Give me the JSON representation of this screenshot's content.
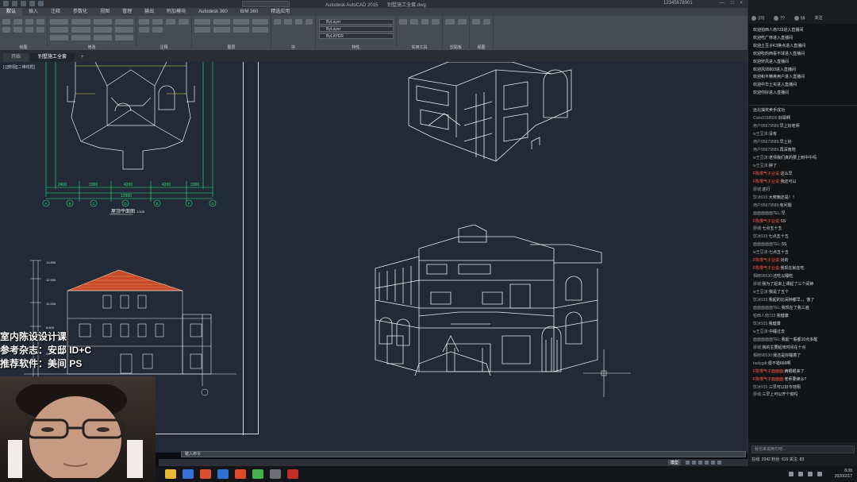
{
  "window": {
    "title": "Autodesk AutoCAD 2015",
    "filename": "别墅施工全套.dwg",
    "user_label": "12345678901",
    "controls": [
      "—",
      "□",
      "×"
    ]
  },
  "menu_tabs": [
    "默认",
    "插入",
    "注释",
    "参数化",
    "视图",
    "管理",
    "输出",
    "附加模块",
    "Autodesk 360",
    "BIM 360",
    "精选应用"
  ],
  "ribbon": {
    "panels": [
      "绘图",
      "修改",
      "注释",
      "图层",
      "块",
      "特性",
      "实用工具",
      "剪贴板",
      "视图"
    ],
    "layer_combo": "ByLayer",
    "linetype_combo": "ByLayer",
    "lineweight_combo": "ByLAYER"
  },
  "doc_tabs": [
    "开始",
    "别墅施工全套"
  ],
  "view_label": "[-][俯视][二维线框]",
  "drawing": {
    "plan_title": "屋顶平面图",
    "plan_scale": "1:100",
    "plan_dims": [
      "2400",
      "3300",
      "4200",
      "4200",
      "3300",
      "12900"
    ],
    "axis_bubbles": [
      "A",
      "B",
      "C",
      "D",
      "E",
      "F",
      "G"
    ],
    "elev_levels": [
      "13.800",
      "12.900",
      "10.200",
      "6.600",
      "3.300"
    ]
  },
  "command_placeholder": "键入命令",
  "status": {
    "model": "模型"
  },
  "overlay_text": [
    "室内陈设设计课",
    "参考杂志：安邸 ID+C",
    "推荐软件：美间 PS"
  ],
  "chat": {
    "header_tabs": [
      "370",
      "??",
      "59",
      "关注"
    ],
    "system_messages": [
      "欢迎拍西人南733进入直播间",
      "欢迎吃广林进入直播间",
      "欢迎土豆子K3换点进入直播间",
      "欢迎吹的西看不球进入直播间",
      "欢迎轩风进入直播间",
      "欢迎风95803进入直播间",
      "欢迎和平精英用户进入直播间",
      "欢迎中华土实进入直播间",
      "欢迎你好进入直播间"
    ],
    "messages": [
      {
        "name": "",
        "text": "远北抽奖卖手成功"
      },
      {
        "name": "Cicle9158505:",
        "text": "好耶啊"
      },
      {
        "name": "用户95679589:",
        "text": "早上好老师"
      },
      {
        "name": "w王豆沫:",
        "text": "没有"
      },
      {
        "name": "用户95679589:",
        "text": "早上好"
      },
      {
        "name": "用户95679589:",
        "text": "再深南地"
      },
      {
        "name": "w王豆沫:",
        "text": "老师我们真的要上到中午吗"
      },
      {
        "name": "w王豆沫:",
        "text": "肿了"
      },
      {
        "name": "F陈慢气子业说:",
        "text": "这么早",
        "red": true
      },
      {
        "name": "F陈慢气子业说:",
        "text": "我还可以",
        "red": true
      },
      {
        "name": "廖城:",
        "text": "还行"
      },
      {
        "name": "饮冰915:",
        "text": "大佬晚还是！！"
      },
      {
        "name": "用户95679589:",
        "text": "有问题"
      },
      {
        "name": "面面面面面TEL:",
        "text": "早"
      },
      {
        "name": "F陈慢气子业说:",
        "text": "SS",
        "red": true
      },
      {
        "name": "廖城:",
        "text": "七点五十五"
      },
      {
        "name": "饮冰915:",
        "text": "七点五十五"
      },
      {
        "name": "面面面面面TEL:",
        "text": "SS"
      },
      {
        "name": "w王豆沫:",
        "text": "七点五十五"
      },
      {
        "name": "F陈慢气子业说:",
        "text": "对的",
        "red": true
      },
      {
        "name": "F陈慢气子业说:",
        "text": "我现在就在吃",
        "red": true
      },
      {
        "name": "相郎95530:",
        "text": "还吃以睡吃"
      },
      {
        "name": "廖城:",
        "text": "我为了起来上课起了三个闹钟"
      },
      {
        "name": "w王豆沫:",
        "text": "我是了五个"
      },
      {
        "name": "饮冰915:",
        "text": "我起的比闹钟都早，，饿了"
      },
      {
        "name": "面面面面面TEL:",
        "text": "我现在了我三遍"
      },
      {
        "name": "柏西人南733:",
        "text": "我健康"
      },
      {
        "name": "饮冰915:",
        "text": "我健康"
      },
      {
        "name": "w王豆沫:",
        "text": "中睡过去"
      },
      {
        "name": "面面面面面TEL:",
        "text": "我起一般都10点多醒"
      },
      {
        "name": "廖城:",
        "text": "我的主要起床时间在十点"
      },
      {
        "name": "相郎95530:",
        "text": "我还是好睡着了"
      },
      {
        "name": "hsdygdt:",
        "text": "很不错666啊"
      },
      {
        "name": "F陈慢气子面面面:",
        "text": "两眼眼来了",
        "red": true
      },
      {
        "name": "F陈慢气子面面面:",
        "text": "老师要蜂么?",
        "red": true
      },
      {
        "name": "饮冰915:",
        "text": "三早可以好今地阳"
      },
      {
        "name": "廖城:",
        "text": "三早上可以开个窗吗"
      }
    ],
    "input_placeholder": "我也来说两句吧...",
    "stats": "在线: 2342  粉丝: 615  关注: 83"
  },
  "taskbar": {
    "time": "8:38",
    "date": "2020/2/17"
  },
  "colors": {
    "canvas_bg": "#212a36",
    "cad_green": "#35e27a",
    "cad_white": "#e8ecf0",
    "cad_yellow": "#e6d94a",
    "roof_red": "#c84a2a",
    "chat_red": "#ff5a4e"
  }
}
